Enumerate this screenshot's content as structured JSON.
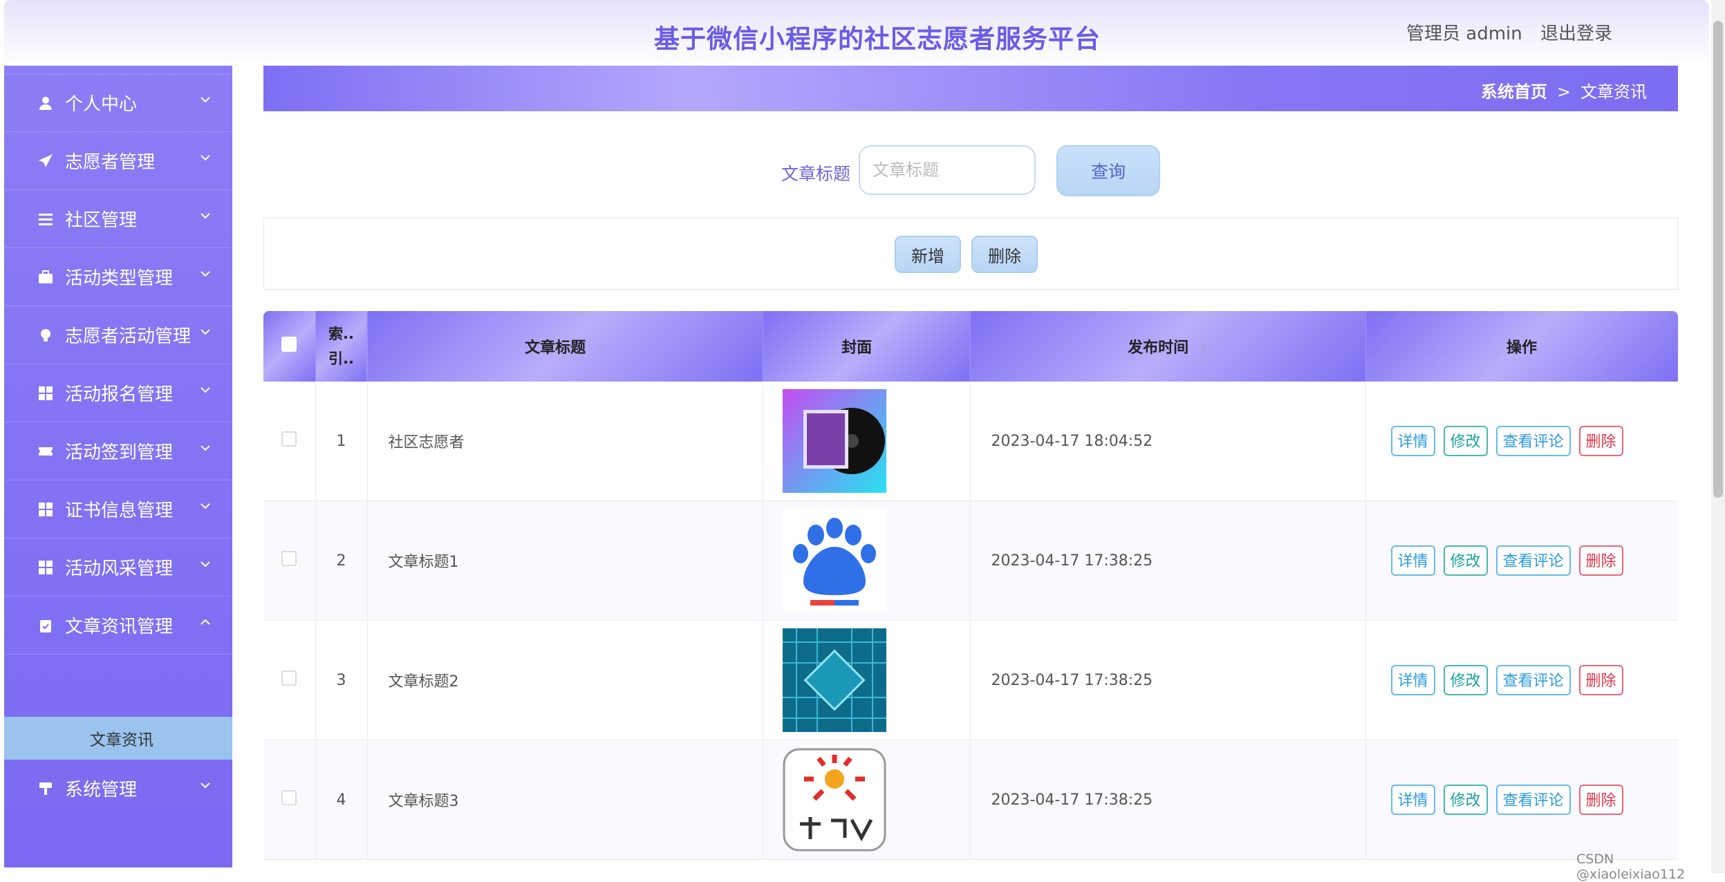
{
  "header": {
    "title": "基于微信小程序的社区志愿者服务平台",
    "user_role": "管理员 admin",
    "logout": "退出登录"
  },
  "sidebar": {
    "items": [
      {
        "label": "个人中心",
        "icon": "user-icon"
      },
      {
        "label": "志愿者管理",
        "icon": "paper-plane-icon"
      },
      {
        "label": "社区管理",
        "icon": "list-icon"
      },
      {
        "label": "活动类型管理",
        "icon": "briefcase-icon"
      },
      {
        "label": "志愿者活动管理",
        "icon": "lightbulb-icon"
      },
      {
        "label": "活动报名管理",
        "icon": "grid-icon"
      },
      {
        "label": "活动签到管理",
        "icon": "ticket-icon"
      },
      {
        "label": "证书信息管理",
        "icon": "grid-icon"
      },
      {
        "label": "活动风采管理",
        "icon": "grid-icon"
      },
      {
        "label": "文章资讯管理",
        "icon": "clipboard-icon"
      },
      {
        "label": "系统管理",
        "icon": "paint-roller-icon"
      }
    ],
    "active_sub": "文章资讯"
  },
  "breadcrumb": {
    "home": "系统首页",
    "separator": ">",
    "current": "文章资讯"
  },
  "search": {
    "label": "文章标题",
    "placeholder": "文章标题",
    "value": "",
    "button": "查询"
  },
  "actions": {
    "add": "新增",
    "delete": "删除"
  },
  "table": {
    "columns": [
      "索引",
      "文章标题",
      "封面",
      "发布时间",
      "操作"
    ],
    "index_header_display": "索.. 引..",
    "rows": [
      {
        "index": "1",
        "title": "社区志愿者",
        "cover": "music-album-cover",
        "time": "2023-04-17 18:04:52"
      },
      {
        "index": "2",
        "title": "文章标题1",
        "cover": "baidu-logo",
        "time": "2023-04-17 17:38:25"
      },
      {
        "index": "3",
        "title": "文章标题2",
        "cover": "circuit-chip-image",
        "time": "2023-04-17 17:38:25"
      },
      {
        "index": "4",
        "title": "文章标题3",
        "cover": "huashu-tv-logo",
        "time": "2023-04-17 17:38:25"
      }
    ],
    "ops": {
      "detail": "详情",
      "edit": "修改",
      "review": "查看评论",
      "delete": "删除"
    }
  },
  "colors": {
    "accent": "#7c6df1",
    "title": "#6a5be6",
    "delete": "#e0364c"
  },
  "watermark": "CSDN @xiaoleixiao112"
}
